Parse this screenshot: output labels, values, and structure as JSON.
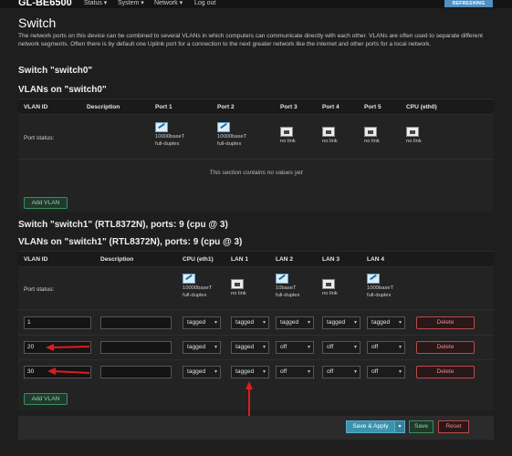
{
  "app": {
    "brand": "GL-BE6500",
    "refresh_badge": "REFRESHING"
  },
  "nav": [
    {
      "label": "Status ▾"
    },
    {
      "label": "System ▾"
    },
    {
      "label": "Network ▾"
    },
    {
      "label": "Log out"
    }
  ],
  "page": {
    "title": "Switch",
    "description": "The network ports on this device can be combined to several VLANs in which computers can communicate directly with each other. VLANs are often used to separate different network segments. Often there is by default one Uplink port for a connection to the next greater network like the internet and other ports for a local network."
  },
  "switch0": {
    "title": "Switch \"switch0\"",
    "vlans_title": "VLANs on \"switch0\"",
    "headers": [
      "VLAN ID",
      "Description",
      "Port 1",
      "Port 2",
      "Port 3",
      "Port 4",
      "Port 5",
      "CPU (eth0)"
    ],
    "port_status_label": "Port status:",
    "ports": [
      {
        "line1": "10000baseT",
        "line2": "full-duplex",
        "link": true
      },
      {
        "line1": "10000baseT",
        "line2": "full-duplex",
        "link": true
      },
      {
        "line1": "no link",
        "line2": "",
        "link": false
      },
      {
        "line1": "no link",
        "line2": "",
        "link": false
      },
      {
        "line1": "no link",
        "line2": "",
        "link": false
      },
      {
        "line1": "no link",
        "line2": "",
        "link": false
      }
    ],
    "empty_text": "This section contains no values yet",
    "add_vlan": "Add VLAN"
  },
  "switch1": {
    "title": "Switch \"switch1\" (RTL8372N), ports: 9 (cpu @ 3)",
    "vlans_title": "VLANs on \"switch1\" (RTL8372N), ports: 9 (cpu @ 3)",
    "headers": [
      "VLAN ID",
      "Description",
      "CPU (eth1)",
      "LAN 1",
      "LAN 2",
      "LAN 3",
      "LAN 4"
    ],
    "port_status_label": "Port status:",
    "ports": [
      {
        "line1": "10000baseT",
        "line2": "full-duplex",
        "link": true
      },
      {
        "line1": "no link",
        "line2": "",
        "link": false
      },
      {
        "line1": "10baseT",
        "line2": "full-duplex",
        "link": true
      },
      {
        "line1": "no link",
        "line2": "",
        "link": false
      },
      {
        "line1": "1000baseT",
        "line2": "full-duplex",
        "link": true
      }
    ],
    "rows": [
      {
        "vlan_id": "1",
        "description": "",
        "values": [
          "tagged",
          "tagged",
          "tagged",
          "tagged",
          "tagged"
        ],
        "delete": "Delete"
      },
      {
        "vlan_id": "20",
        "description": "",
        "values": [
          "tagged",
          "tagged",
          "off",
          "off",
          "off"
        ],
        "delete": "Delete"
      },
      {
        "vlan_id": "30",
        "description": "",
        "values": [
          "tagged",
          "tagged",
          "off",
          "off",
          "off"
        ],
        "delete": "Delete"
      }
    ],
    "add_vlan": "Add VLAN"
  },
  "footer": {
    "save_apply": "Save & Apply",
    "save": "Save",
    "reset": "Reset"
  },
  "colors": {
    "annotation_arrow": "#e01b1b",
    "background": "#1e1e1e",
    "accent": "#3b93ad"
  }
}
